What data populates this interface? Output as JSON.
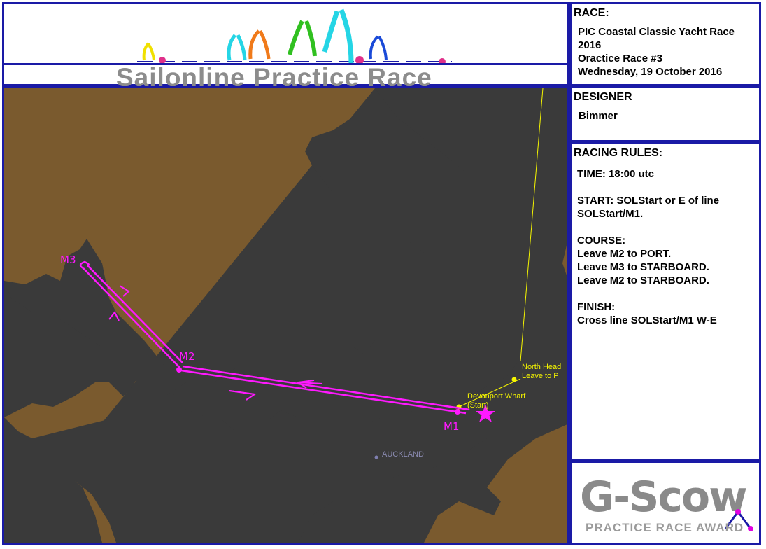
{
  "banner": {
    "title": "Sailonline Practice Race"
  },
  "race": {
    "heading": "RACE:",
    "lines": [
      "PIC Coastal Classic Yacht Race",
      "2016",
      "Oractice Race #3",
      "Wednesday, 19 October 2016"
    ]
  },
  "designer": {
    "heading": "DESIGNER",
    "name": "Bimmer"
  },
  "rules": {
    "heading": "RACING RULES:",
    "time": "TIME: 18:00 utc",
    "start_lines": [
      "START: SOLStart or E of line",
      "SOLStart/M1."
    ],
    "course_lines": [
      "COURSE:",
      "Leave M2 to PORT.",
      "Leave M3 to STARBOARD.",
      "Leave M2 to STARBOARD."
    ],
    "finish_lines": [
      "FINISH:",
      "Cross line SOLStart/M1 W-E"
    ]
  },
  "award": {
    "logo": "G-Scow",
    "subtitle": "PRACTICE RACE AWARD"
  },
  "map": {
    "colors": {
      "land": "#7a5a2e",
      "water": "#3a3a3a",
      "course": "#ff19ff",
      "waypoint": "#f5f500"
    },
    "marks": [
      "M1",
      "M2",
      "M3"
    ],
    "waypoint_labels": {
      "north_head": [
        "North Head",
        "Leave to P"
      ],
      "devonport": [
        "Devonport Wharf",
        "(Start)"
      ]
    },
    "city_label": "AUCKLAND"
  }
}
